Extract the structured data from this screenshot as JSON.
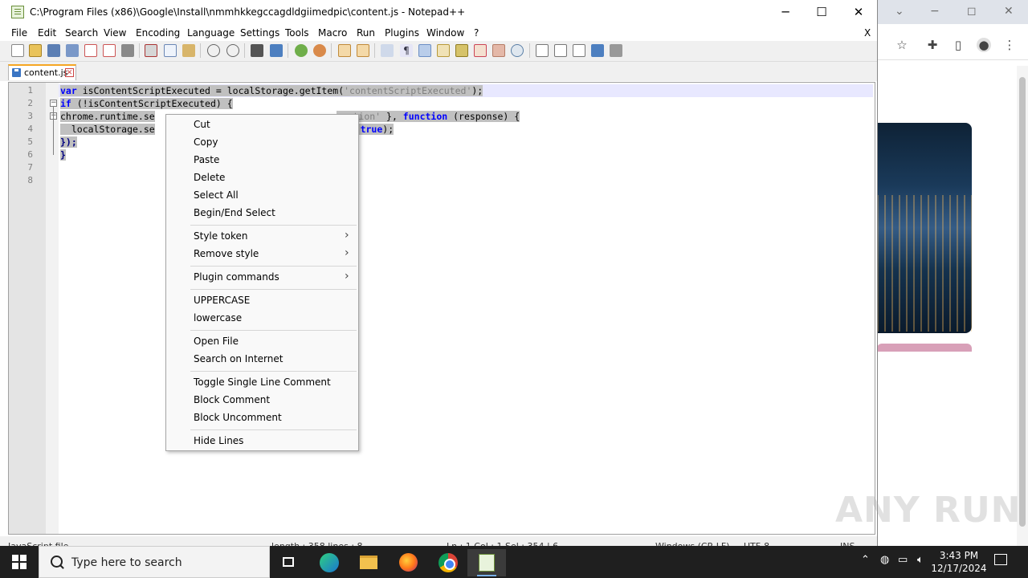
{
  "chrome": {
    "min": "−",
    "max": "◻",
    "close": "✕",
    "chevron": "⌄"
  },
  "npp": {
    "title": "C:\\Program Files (x86)\\Google\\Install\\nmmhkkegccagdldgiimedpic\\content.js - Notepad++",
    "window_close_x": "X",
    "menu": [
      "File",
      "Edit",
      "Search",
      "View",
      "Encoding",
      "Language",
      "Settings",
      "Tools",
      "Macro",
      "Run",
      "Plugins",
      "Window",
      "?"
    ],
    "tab": {
      "label": "content.js"
    },
    "line_numbers": [
      "1",
      "2",
      "3",
      "4",
      "5",
      "6",
      "7",
      "8"
    ],
    "code": {
      "l1_kw": "var",
      "l1_a": " isContentScriptExecuted = localStorage.getItem(",
      "l1_str": "'contentScriptExecuted'",
      "l1_b": ");",
      "l2_kw": "if",
      "l2_a": " (!isContentScriptExecuted) {",
      "l3_a": "chrome.runtime.se",
      "l3_str": "unction'",
      "l3_b": " }, ",
      "l3_kw": "function",
      "l3_c": " (response) {",
      "l4_a": "  localStorage.se",
      "l4_b": ", ",
      "l4_kw": "true",
      "l4_c": ");",
      "l5": "});",
      "l6": "}"
    },
    "status": {
      "type": "JavaScript file",
      "length": "length : 358    lines : 8",
      "pos": "Ln : 1    Col : 1    Sel : 354 | 6",
      "eol": "Windows (CR LF)",
      "enc": "UTF-8",
      "mode": "INS"
    }
  },
  "context_menu": {
    "items": [
      {
        "label": "Cut"
      },
      {
        "label": "Copy"
      },
      {
        "label": "Paste"
      },
      {
        "label": "Delete"
      },
      {
        "label": "Select All"
      },
      {
        "label": "Begin/End Select"
      },
      {
        "label": "Style token",
        "submenu": true
      },
      {
        "label": "Remove style",
        "submenu": true
      },
      {
        "label": "Plugin commands",
        "submenu": true
      },
      {
        "label": "UPPERCASE"
      },
      {
        "label": "lowercase"
      },
      {
        "label": "Open File"
      },
      {
        "label": "Search on Internet"
      },
      {
        "label": "Toggle Single Line Comment"
      },
      {
        "label": "Block Comment"
      },
      {
        "label": "Block Uncomment"
      },
      {
        "label": "Hide Lines"
      }
    ],
    "submenu_arrow": "›"
  },
  "watermark": "ANY RUN",
  "taskbar": {
    "search_placeholder": "Type here to search",
    "time": "3:43 PM",
    "date": "12/17/2024"
  }
}
